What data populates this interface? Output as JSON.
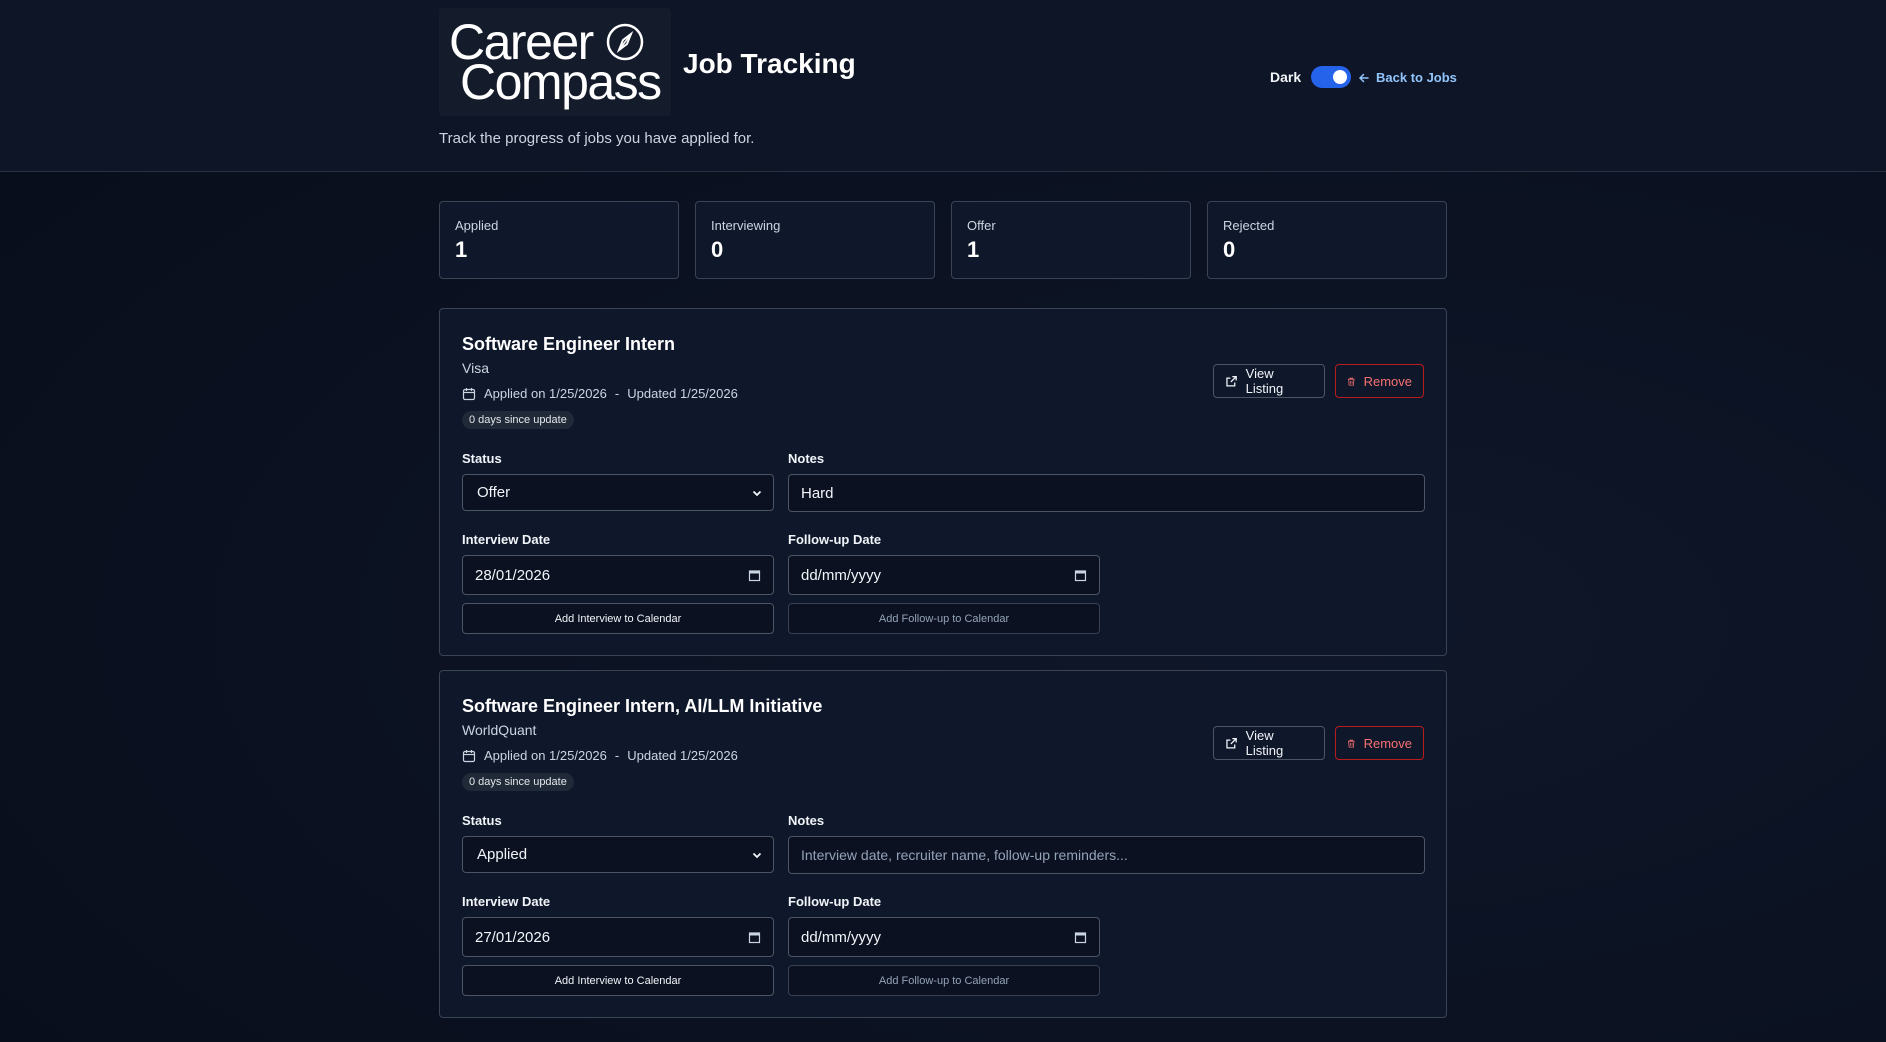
{
  "header": {
    "logo_line1": "Career",
    "logo_line2": "Compass",
    "title": "Job Tracking",
    "subtitle": "Track the progress of jobs you have applied for.",
    "theme_label": "Dark",
    "back_link": "Back to Jobs"
  },
  "stats": [
    {
      "label": "Applied",
      "value": "1"
    },
    {
      "label": "Interviewing",
      "value": "0"
    },
    {
      "label": "Offer",
      "value": "1"
    },
    {
      "label": "Rejected",
      "value": "0"
    }
  ],
  "jobs": [
    {
      "title": "Software Engineer Intern",
      "company": "Visa",
      "applied": "Applied on 1/25/2026",
      "separator": "-",
      "updated": "Updated 1/25/2026",
      "badge": "0 days since update",
      "view_label": "View Listing",
      "remove_label": "Remove",
      "status_label": "Status",
      "status_value": "Offer",
      "notes_label": "Notes",
      "notes_value": "Hard",
      "interview_label": "Interview Date",
      "interview_value": "28/01/2026",
      "followup_label": "Follow-up Date",
      "followup_value": "dd/mm/yyyy",
      "add_interview": "Add Interview to Calendar",
      "add_followup": "Add Follow-up to Calendar"
    },
    {
      "title": "Software Engineer Intern, AI/LLM Initiative",
      "company": "WorldQuant",
      "applied": "Applied on 1/25/2026",
      "separator": "-",
      "updated": "Updated 1/25/2026",
      "badge": "0 days since update",
      "view_label": "View Listing",
      "remove_label": "Remove",
      "status_label": "Status",
      "status_value": "Applied",
      "notes_label": "Notes",
      "notes_placeholder": "Interview date, recruiter name, follow-up reminders...",
      "interview_label": "Interview Date",
      "interview_value": "27/01/2026",
      "followup_label": "Follow-up Date",
      "followup_value": "dd/mm/yyyy",
      "add_interview": "Add Interview to Calendar",
      "add_followup": "Add Follow-up to Calendar"
    }
  ]
}
